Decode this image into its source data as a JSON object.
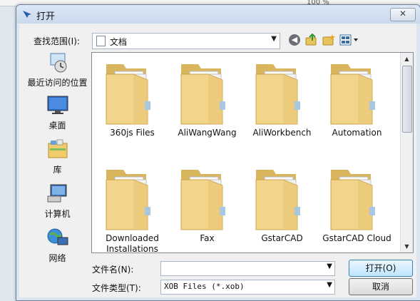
{
  "window": {
    "title": "打开",
    "close_label": "✕"
  },
  "background": {
    "toolbar_fragment": "100 %"
  },
  "toolbar": {
    "look_in_label": "查找范围(I):",
    "look_in_value": "文档",
    "back_icon": "back-arrow-icon",
    "up_icon": "up-folder-icon",
    "new_folder_icon": "new-folder-icon",
    "views_icon": "views-menu-icon"
  },
  "places": [
    {
      "label": "最近访问的位置",
      "icon": "recent-places-icon"
    },
    {
      "label": "桌面",
      "icon": "desktop-icon"
    },
    {
      "label": "库",
      "icon": "libraries-icon"
    },
    {
      "label": "计算机",
      "icon": "computer-icon"
    },
    {
      "label": "网络",
      "icon": "network-icon"
    }
  ],
  "files": [
    {
      "name": "360js Files"
    },
    {
      "name": "AliWangWang"
    },
    {
      "name": "AliWorkbench"
    },
    {
      "name": "Automation"
    },
    {
      "name": "Downloaded Installations"
    },
    {
      "name": "Fax"
    },
    {
      "name": "GstarCAD"
    },
    {
      "name": "GstarCAD Cloud"
    }
  ],
  "filename": {
    "label": "文件名(N):",
    "value": ""
  },
  "filetype": {
    "label": "文件类型(T):",
    "value": "XOB Files (*.xob)"
  },
  "buttons": {
    "open": "打开(O)",
    "cancel": "取消"
  },
  "colors": {
    "folder": "#f2d58a",
    "folder_dark": "#d9b55d",
    "accent": "#3c7fb1"
  }
}
